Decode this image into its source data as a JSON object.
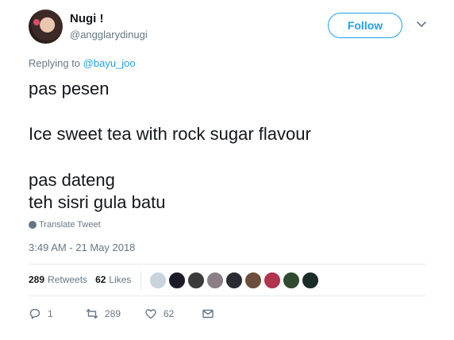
{
  "author": {
    "name": "Nugi !",
    "handle": "@angglarydinugi"
  },
  "follow_label": "Follow",
  "reply": {
    "prefix": "Replying to",
    "handle": "@bayu_joo"
  },
  "tweet": {
    "line1": "pas pesen",
    "line2": "Ice sweet tea with rock sugar flavour",
    "line3": "pas dateng",
    "line4": "teh sisri gula batu"
  },
  "translate_label": "Translate Tweet",
  "timestamp": "3:49 AM - 21 May 2018",
  "stats": {
    "retweets_count": "289",
    "retweets_label": "Retweets",
    "likes_count": "62",
    "likes_label": "Likes"
  },
  "liker_colors": [
    "#c9d3dc",
    "#1b1b2a",
    "#3a3a3a",
    "#8a7f86",
    "#2b2b33",
    "#6b4e3d",
    "#b0344d",
    "#2f4a2f",
    "#1a2b2a"
  ],
  "actions": {
    "reply_count": "1",
    "retweet_count": "289",
    "like_count": "62"
  },
  "colors": {
    "accent": "#1da1f2",
    "secondary_text": "#657786"
  }
}
